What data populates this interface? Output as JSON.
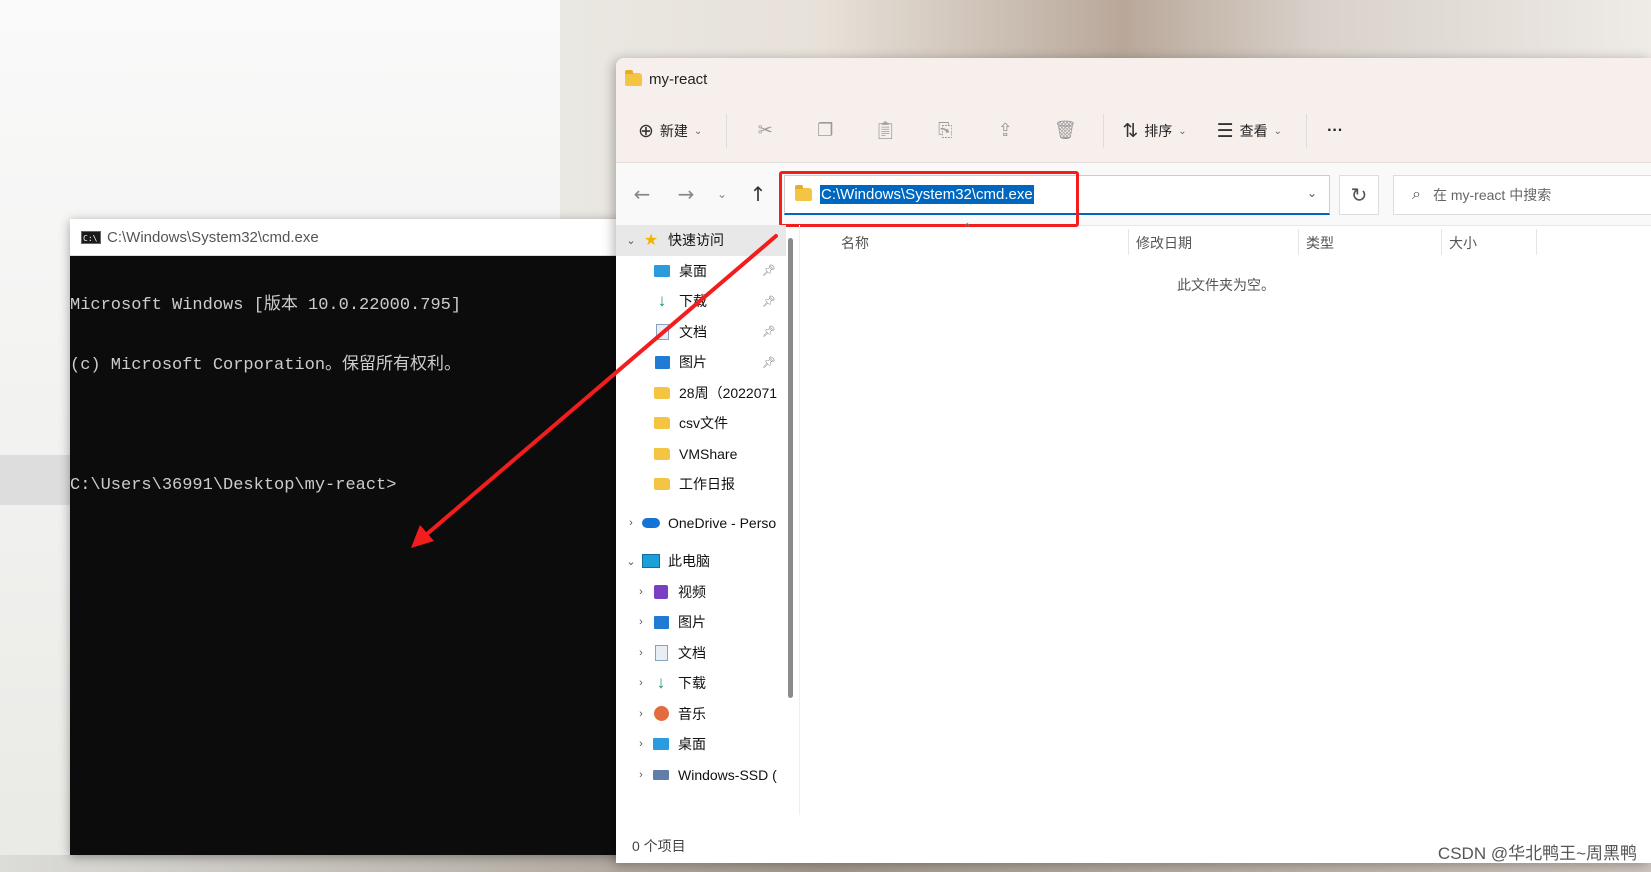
{
  "cmd": {
    "title": "C:\\Windows\\System32\\cmd.exe",
    "icon": "cmd-icon",
    "lines": [
      "Microsoft Windows [版本 10.0.22000.795]",
      "(c) Microsoft Corporation。保留所有权利。",
      "",
      "C:\\Users\\36991\\Desktop\\my-react>"
    ]
  },
  "explorer": {
    "title": "my-react",
    "toolbar": {
      "new_label": "新建",
      "sort_label": "排序",
      "view_label": "查看",
      "more_label": "···"
    },
    "address": "C:\\Windows\\System32\\cmd.exe",
    "search_placeholder": "在 my-react 中搜索",
    "sidebar": {
      "quick_access": "快速访问",
      "quick_items": [
        "桌面",
        "下载",
        "文档",
        "图片",
        "28周（2022071",
        "csv文件",
        "VMShare",
        "工作日报"
      ],
      "onedrive": "OneDrive - Perso",
      "this_pc": "此电脑",
      "pc_items": [
        "视频",
        "图片",
        "文档",
        "下载",
        "音乐",
        "桌面",
        "Windows-SSD ("
      ]
    },
    "columns": [
      "名称",
      "修改日期",
      "类型",
      "大小"
    ],
    "empty_text": "此文件夹为空。",
    "status": "0 个项目"
  },
  "watermark": "CSDN @华北鸭王~周黑鸭",
  "colors": {
    "selection": "#0067c0",
    "annotation": "#f21d1d"
  }
}
